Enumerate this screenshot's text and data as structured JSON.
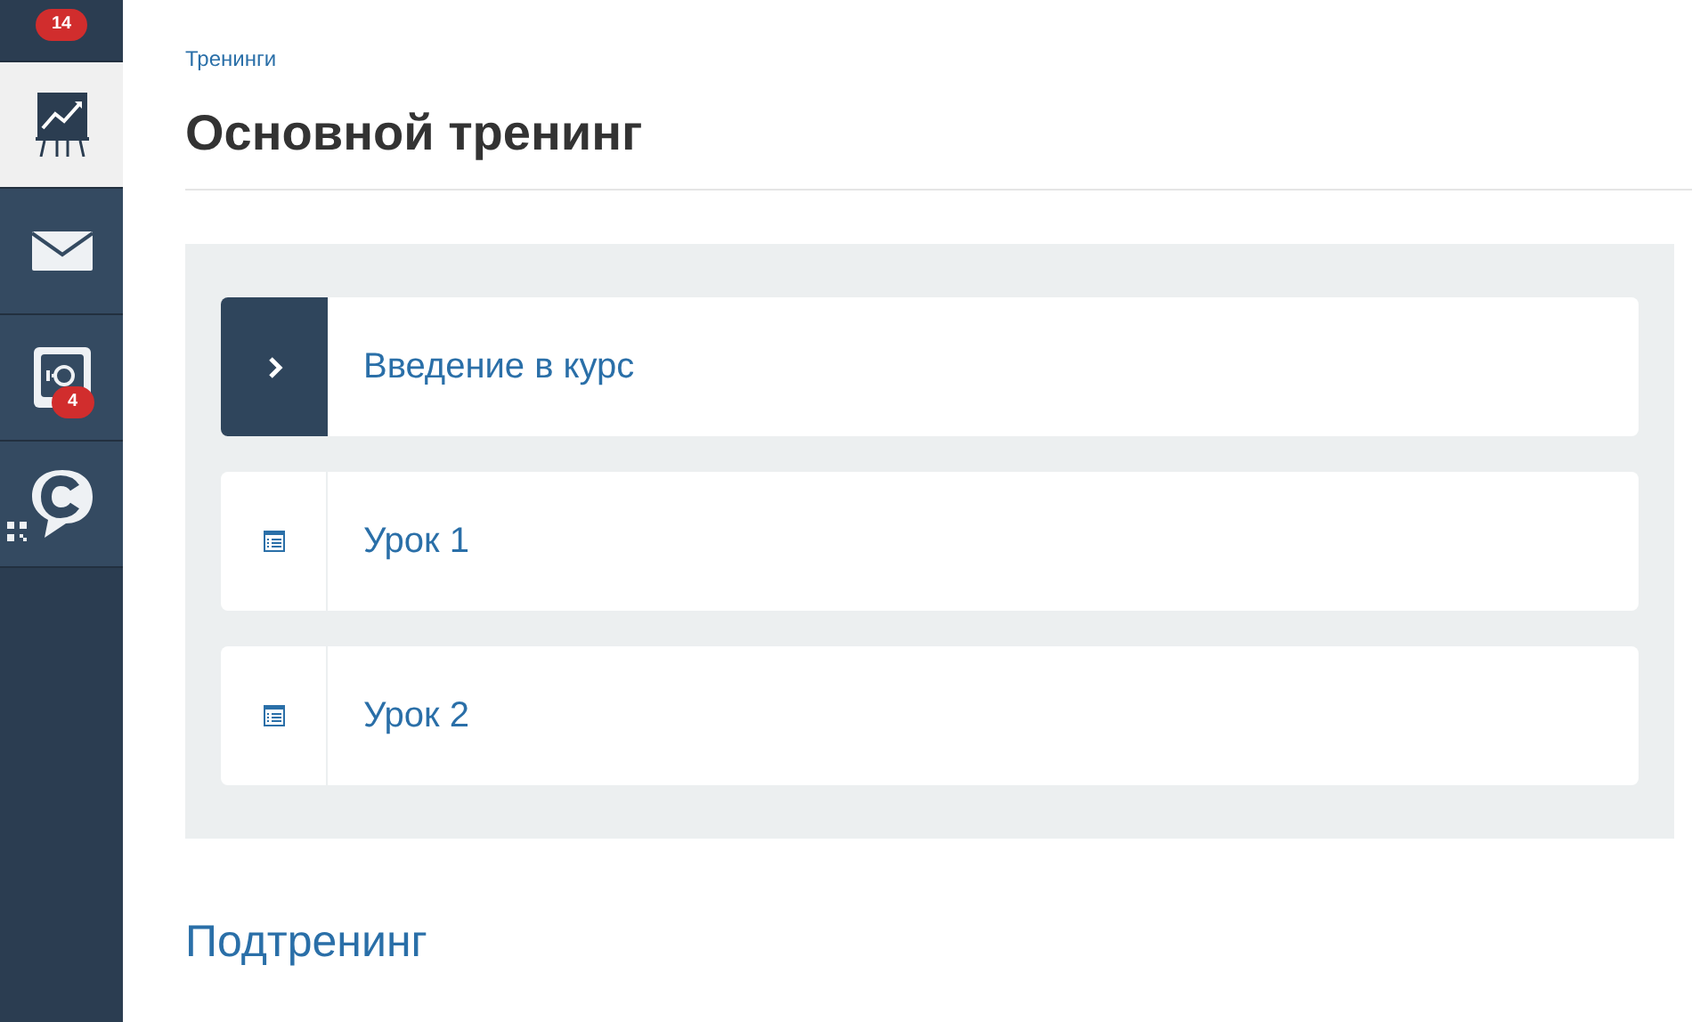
{
  "sidebar": {
    "top_badge": "14",
    "items": [
      {
        "kind": "chart",
        "selected": true
      },
      {
        "kind": "mail",
        "selected": false
      },
      {
        "kind": "safe",
        "selected": false,
        "badge": "4"
      },
      {
        "kind": "chat",
        "selected": false
      }
    ]
  },
  "breadcrumb": "Тренинги",
  "title": "Основной тренинг",
  "lessons": [
    {
      "kind": "section",
      "label": "Введение в курс"
    },
    {
      "kind": "lesson",
      "label": "Урок 1"
    },
    {
      "kind": "lesson",
      "label": "Урок 2"
    }
  ],
  "subtraining": "Подтренинг"
}
